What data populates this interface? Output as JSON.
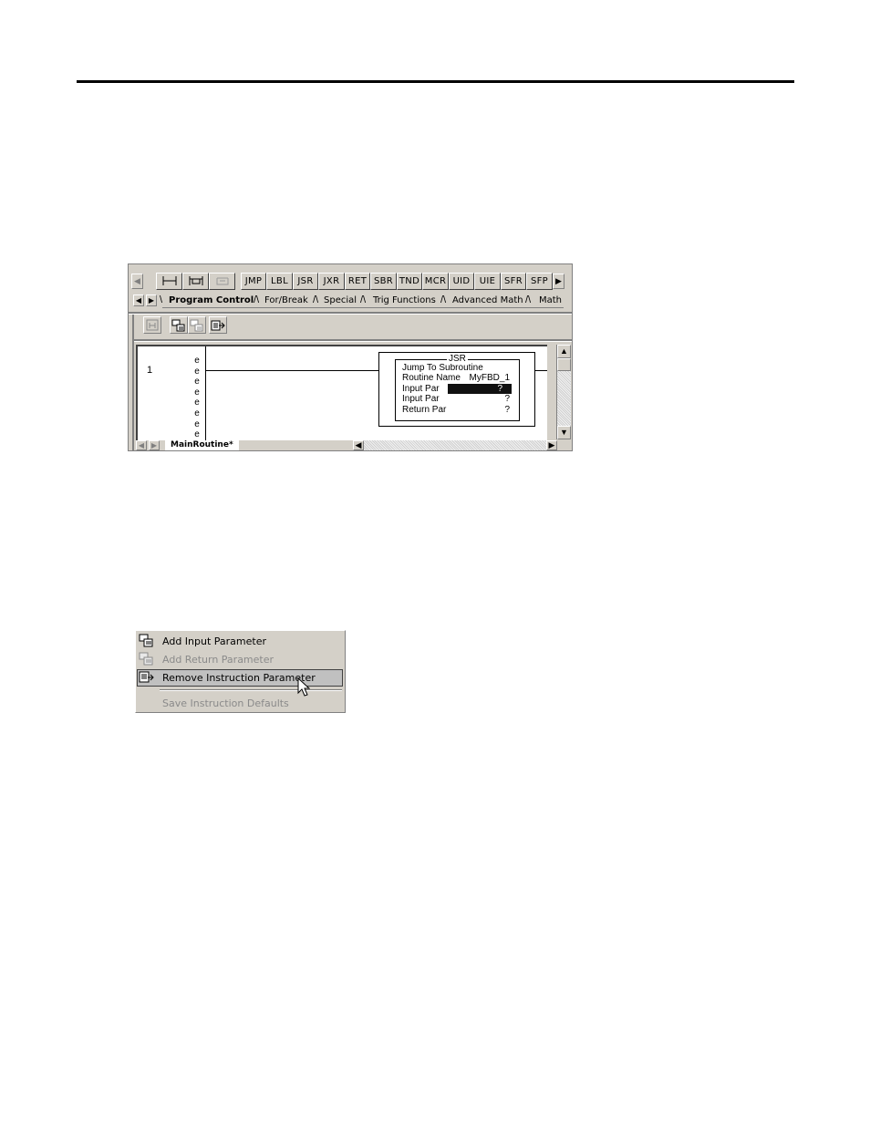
{
  "editor": {
    "scroll_left": "◀",
    "scroll_right": "▶",
    "instruction_buttons": [
      "JMP",
      "LBL",
      "JSR",
      "JXR",
      "RET",
      "SBR",
      "TND",
      "MCR",
      "UID",
      "UIE",
      "SFR",
      "SFP"
    ],
    "tab_nav_left": "◀",
    "tab_nav_right": "▶",
    "tabs": [
      "Program Control",
      "For/Break",
      "Special",
      "Trig Functions",
      "Advanced Math",
      "Math"
    ],
    "active_tab": "Program Control",
    "rung_number": "1",
    "rung_markers": [
      "e",
      "e",
      "e",
      "e",
      "e",
      "e",
      "e",
      "e"
    ],
    "jsr": {
      "title": "JSR",
      "description": "Jump To Subroutine",
      "routine_name_label": "Routine Name",
      "routine_name_value": "MyFBD_1",
      "params": [
        {
          "label": "Input Par",
          "value": "?",
          "highlighted": true
        },
        {
          "label": "Input Par",
          "value": "?",
          "highlighted": false
        },
        {
          "label": "Return Par",
          "value": "?",
          "highlighted": false
        }
      ]
    },
    "sheet_tab": "MainRoutine*",
    "vscroll_up": "▲",
    "vscroll_down": "▼",
    "hscroll_left": "◀",
    "hscroll_right": "▶"
  },
  "context_menu": {
    "items": [
      {
        "label": "Add Input Parameter",
        "icon": "add-input-parameter-icon",
        "enabled": true
      },
      {
        "label": "Add Return Parameter",
        "icon": "add-return-parameter-icon",
        "enabled": false
      },
      {
        "label": "Remove Instruction Parameter",
        "icon": "remove-parameter-icon",
        "enabled": true,
        "selected": true
      },
      {
        "label": "Save Instruction Defaults",
        "icon": "",
        "enabled": false
      }
    ]
  }
}
